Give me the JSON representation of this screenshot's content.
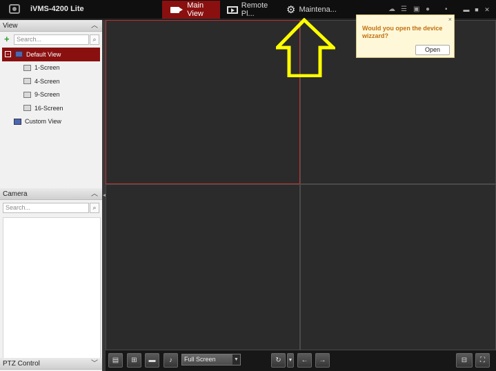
{
  "app": {
    "title": "iVMS-4200 Lite"
  },
  "tabs": [
    {
      "label": "Main View",
      "icon": "camera-icon"
    },
    {
      "label": "Remote Pl...",
      "icon": "film-icon"
    },
    {
      "label": "Maintena...",
      "icon": "gear-icon"
    }
  ],
  "view_panel": {
    "header": "View",
    "search_placeholder": "Search...",
    "tree": [
      {
        "label": "Default View",
        "selected": true
      },
      {
        "label": "1-Screen"
      },
      {
        "label": "4-Screen"
      },
      {
        "label": "9-Screen"
      },
      {
        "label": "16-Screen"
      },
      {
        "label": "Custom View"
      }
    ]
  },
  "camera_panel": {
    "header": "Camera",
    "search_placeholder": "Search..."
  },
  "ptz_panel": {
    "header": "PTZ Control"
  },
  "popup": {
    "message": "Would you open the device wizzard?",
    "open_label": "Open",
    "close_label": "×"
  },
  "bottom_toolbar": {
    "fullscreen_label": "Full Screen"
  },
  "colors": {
    "accent": "#8a1010",
    "popup_bg": "#fff8d8",
    "popup_text": "#c07010",
    "annotation": "#ffff00"
  }
}
